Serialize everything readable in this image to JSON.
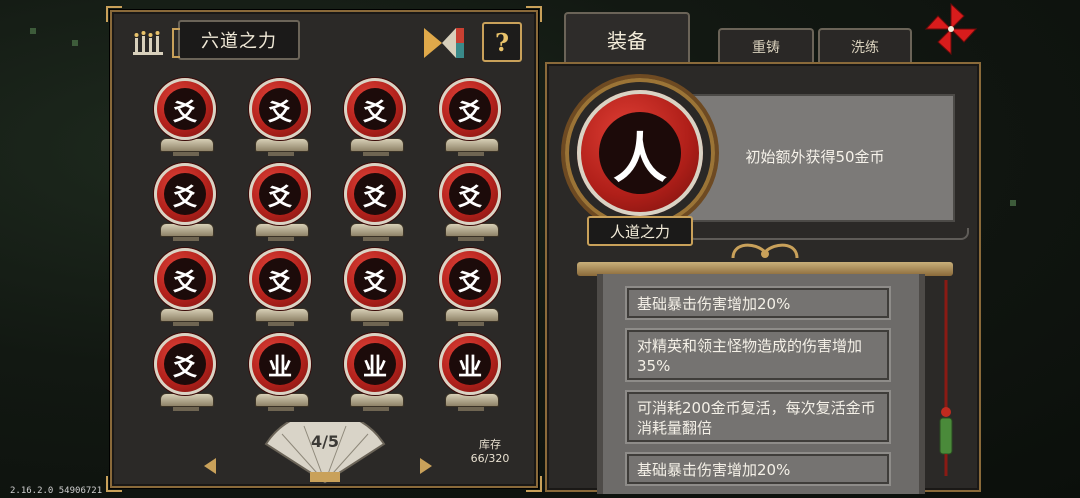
{
  "left": {
    "title": "六道之力",
    "help_label": "?",
    "grid": [
      [
        "爻",
        "爻",
        "爻",
        "爻"
      ],
      [
        "爻",
        "爻",
        "爻",
        "爻"
      ],
      [
        "爻",
        "爻",
        "爻",
        "爻"
      ],
      [
        "爻",
        "业",
        "业",
        "业"
      ]
    ],
    "page_indicator": "4/5",
    "stock_label": "库存",
    "stock_value": "66/320"
  },
  "tabs": {
    "equip": "装备",
    "recast": "重铸",
    "refine": "洗练"
  },
  "detail": {
    "orb_glyph": "人",
    "name": "人道之力",
    "description": "初始额外获得50金币",
    "effects": [
      "基础暴击伤害增加20%",
      "对精英和领主怪物造成的伤害增加35%",
      "可消耗200金币复活，每次复活金币消耗量翻倍",
      "基础暴击伤害增加20%"
    ]
  },
  "version": "2.16.2.0 54906721",
  "colors": {
    "panel": "#2b2927",
    "gold_trim": "#c9a15a",
    "orb_red": "#b4221c"
  }
}
